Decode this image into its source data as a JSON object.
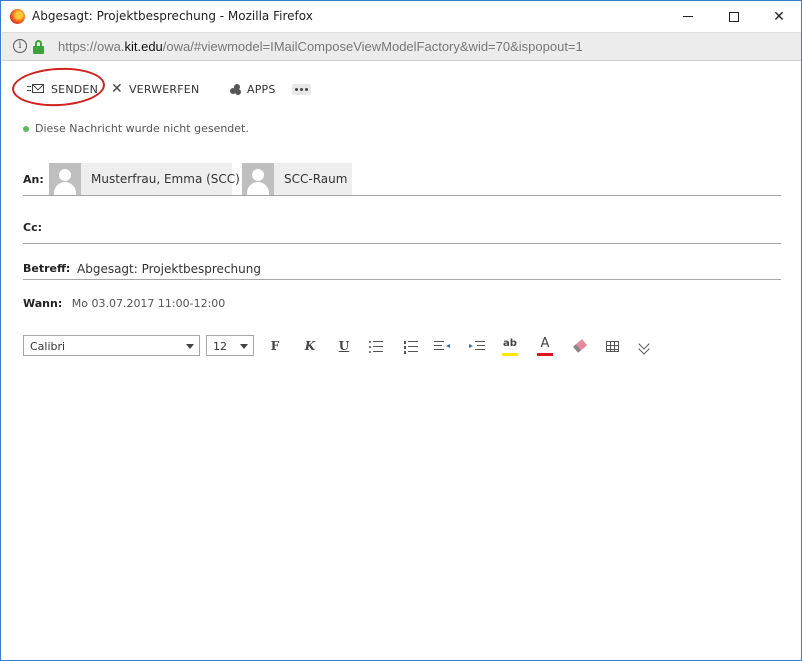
{
  "window": {
    "title": "Abgesagt: Projektbesprechung - Mozilla Firefox",
    "minimize_glyph": "—",
    "close_glyph": "✕"
  },
  "urlbar": {
    "info_glyph": "i",
    "url_prefix": "https://owa.",
    "url_host": "kit.edu",
    "url_path": "/owa/#viewmodel=IMailComposeViewModelFactory&wid=70&ispopout=1"
  },
  "toolbar": {
    "send_label": "SENDEN",
    "discard_label": "VERWERFEN",
    "apps_label": "APPS",
    "discard_glyph": "✕"
  },
  "status": {
    "message": "Diese Nachricht wurde nicht gesendet."
  },
  "compose": {
    "to_label": "An:",
    "recipients": [
      {
        "name": "Musterfrau, Emma (SCC)"
      },
      {
        "name": "SCC-Raum"
      }
    ],
    "cc_label": "Cc:",
    "subject_label": "Betreff:",
    "subject_value": "Abgesagt: Projektbesprechung",
    "when_label": "Wann:",
    "when_value": "Mo 03.07.2017 11:00-12:00"
  },
  "format": {
    "font_value": "Calibri",
    "size_value": "12",
    "bold_glyph": "F",
    "italic_glyph": "K",
    "underline_glyph": "U",
    "spellcheck_glyph": "ab",
    "font_color_glyph": "A",
    "highlight_color": "#ffe600",
    "font_color": "#e0161c",
    "more_glyph": "⌄⌄"
  },
  "colors": {
    "accent_circle": "#d0211d",
    "status_dot": "#5cb85c"
  }
}
